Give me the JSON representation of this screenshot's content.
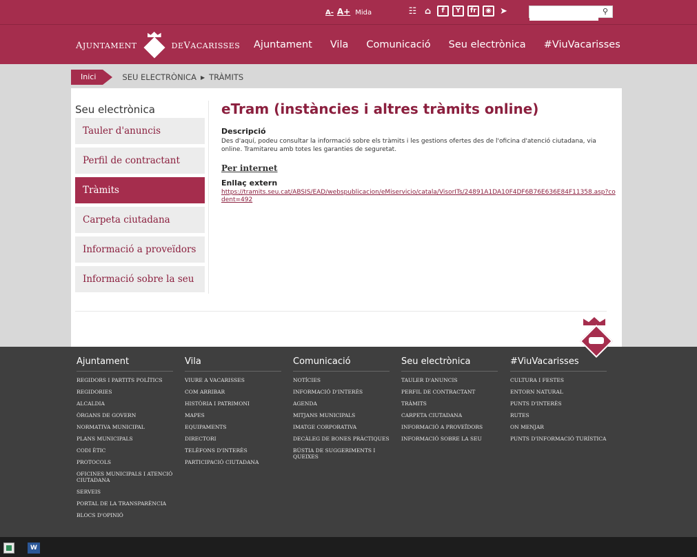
{
  "topbar": {
    "font_small": "A-",
    "font_large": "A+",
    "font_label": "Mida",
    "icons": [
      "sitemap-icon",
      "home-icon",
      "facebook-icon",
      "youtube-icon",
      "flickr-icon",
      "instagram-icon",
      "telegram-icon"
    ],
    "search_placeholder": ""
  },
  "logo": {
    "left_text_cap": "A",
    "left_text": "JUNTAMENT",
    "right_text_de": "DE ",
    "right_text_cap": "V",
    "right_text": "ACARISSES"
  },
  "nav": [
    "Ajuntament",
    "Vila",
    "Comunicació",
    "Seu electrònica",
    "#ViuVacarisses"
  ],
  "breadcrumb": {
    "home": "Inici",
    "section": "SEU ELECTRÒNICA",
    "page": "TRÀMITS"
  },
  "sidebar": {
    "title": "Seu electrònica",
    "items": [
      {
        "label": "Tauler d'anuncis",
        "active": false
      },
      {
        "label": "Perfil de contractant",
        "active": false
      },
      {
        "label": "Tràmits",
        "active": true
      },
      {
        "label": "Carpeta ciutadana",
        "active": false
      },
      {
        "label": "Informació a proveïdors",
        "active": false
      },
      {
        "label": "Informació sobre la seu",
        "active": false
      }
    ]
  },
  "main": {
    "title": "eTram (instàncies i altres tràmits online)",
    "desc_label": "Descripció",
    "desc_text": "Des d'aquí, podeu consultar la informació sobre els tràmits i les gestions ofertes des de l'oficina d'atenció ciutadana, via online. Tramitareu amb totes les garanties de seguretat.",
    "internet_label": "Per internet",
    "ext_label": "Enllaç extern",
    "ext_link": "https://tramits.seu.cat/ABSIS/EAD/webspublicacion/eMiservicio/catala/VisorITs/24891A1DA10F4DF6B76E636E84F11358.asp?codent=492"
  },
  "footer": {
    "columns": [
      {
        "title": "Ajuntament",
        "links": [
          "Regidors i partits polítics",
          "Regidories",
          "Alcaldia",
          "Òrgans de govern",
          "Normativa municipal",
          "Plans municipals",
          "Codi ètic",
          "Protocols",
          "Oficines municipals i atenció ciutadana",
          "Serveis",
          "Portal de la transparència",
          "Blocs d'opinió"
        ]
      },
      {
        "title": "Vila",
        "links": [
          "Viure a Vacarisses",
          "Com arribar",
          "Història i patrimoni",
          "Mapes",
          "Equipaments",
          "Directori",
          "Telèfons d'interès",
          "Participació ciutadana"
        ]
      },
      {
        "title": "Comunicació",
        "links": [
          "Notícies",
          "Informació d'interès",
          "Agenda",
          "Mitjans municipals",
          "Imatge corporativa",
          "Decàleg de bones pràctiques",
          "Bústia de suggeriments i queixes"
        ]
      },
      {
        "title": "Seu electrònica",
        "links": [
          "Tauler d'anuncis",
          "Perfil de contractant",
          "Tràmits",
          "Carpeta ciutadana",
          "Informació a proveïdors",
          "Informació sobre la seu"
        ]
      },
      {
        "title": "#ViuVacarisses",
        "links": [
          "Cultura i festes",
          "Entorn natural",
          "Punts d'interès",
          "Rutes",
          "On menjar",
          "Punts d'informació turística"
        ]
      }
    ]
  },
  "taskbar": {
    "word_label": "W"
  },
  "colors": {
    "brand": "#a52d4d",
    "brand_text": "#8b1f3e",
    "footer_bg": "#3f3f3f"
  }
}
